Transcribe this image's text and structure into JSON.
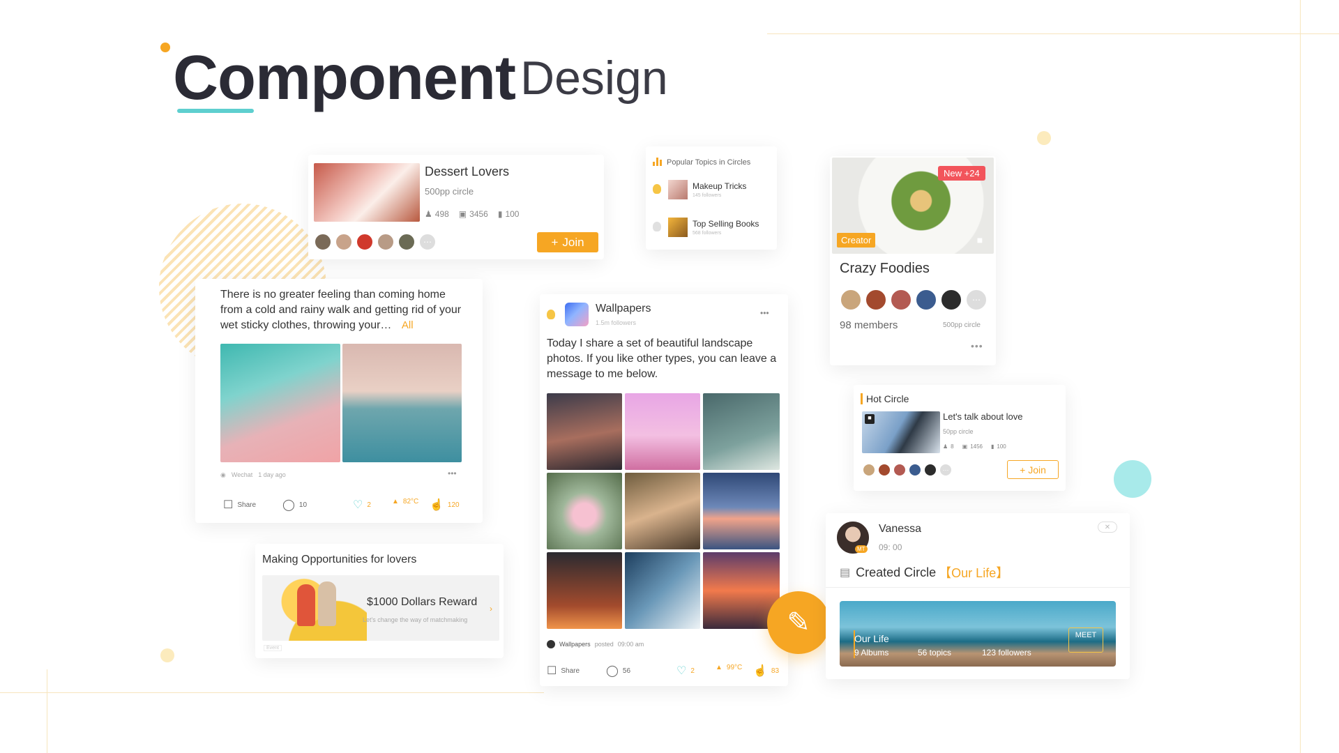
{
  "header": {
    "title_bold": "Component",
    "title_light": "Design"
  },
  "colors": {
    "accent": "#f6a623",
    "teal": "#5ecfcf",
    "text_dark": "#2b2b35"
  },
  "dessert": {
    "name": "Dessert Lovers",
    "sub": "500pp circle",
    "stats": {
      "members": "498",
      "posts": "3456",
      "books": "100"
    },
    "join_label": "Join"
  },
  "popular": {
    "header": "Popular Topics in Circles",
    "items": [
      {
        "name": "Makeup Tricks",
        "followers": "145",
        "followers_label": "followers"
      },
      {
        "name": "Top Selling Books",
        "followers": "568",
        "followers_label": "followers"
      }
    ]
  },
  "foodies": {
    "badge_new": "New +24",
    "badge_creator": "Creator",
    "name": "Crazy Foodies",
    "members": "98 members",
    "size": "500pp circle"
  },
  "post_left": {
    "text": "There is no greater feeling than coming home from a cold and rainy walk and getting rid of your wet sticky clothes, throwing your…",
    "all_label": "All",
    "source": "Wechat",
    "time": "1 day ago",
    "actions": {
      "share": "Share",
      "comments": "10",
      "likes": "2",
      "temp": "82°C",
      "thumbs": "120"
    }
  },
  "wallpapers": {
    "name": "Wallpapers",
    "followers": "1.5m followers",
    "text": "Today I share a set of beautiful landscape photos. If you like other types, you can leave a message to me below.",
    "poster": "Wallpapers",
    "posted_label": "posted",
    "time": "09:00 am",
    "actions": {
      "share": "Share",
      "comments": "56",
      "likes": "2",
      "temp": "99°C",
      "thumbs": "83"
    }
  },
  "hot": {
    "header": "Hot Circle",
    "title": "Let's talk about love",
    "sub": "50pp circle",
    "stats": {
      "members": "8",
      "posts": "1456",
      "books": "100"
    },
    "join_label": "Join"
  },
  "opportunity": {
    "title": "Making Opportunities for lovers",
    "reward": "$1000 Dollars Reward",
    "desc": "Let's change the way of matchmaking",
    "tag": "Event"
  },
  "vanessa": {
    "name": "Vanessa",
    "time": "09: 00",
    "badge": "MT",
    "created_prefix": "Created Circle",
    "created_name": "【Our Life】",
    "banner_title": "Our Life",
    "albums": "9 Albums",
    "topics": "56 topics",
    "followers": "123 followers",
    "meet": "MEET"
  }
}
